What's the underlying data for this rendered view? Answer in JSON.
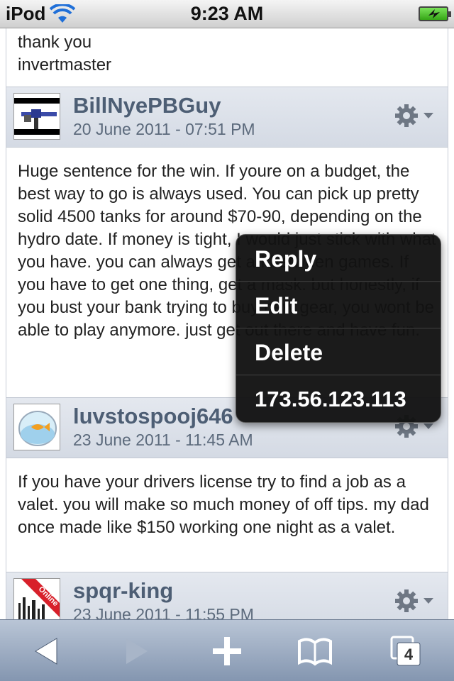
{
  "status_bar": {
    "carrier": "iPod",
    "time": "9:23 AM"
  },
  "top_post": {
    "lines": [
      "thank you",
      "invertmaster"
    ]
  },
  "posts": [
    {
      "username": "BillNyePBGuy",
      "date": "20 June 2011 - 07:51 PM",
      "body": "Huge sentence for the win. If youre on a budget, the best way to go is always used. You can pick up pretty solid 4500 tanks for around $70-90, depending on the hydro date. If money is tight, I would just stick with what you have. you can always get ari between games. If you have to get one thing, get a mask. but honestly, if you bust your bank trying to buy new gear, you wont be able to play anymore. just get out there and have fun."
    },
    {
      "username": "luvstospooj646",
      "date": "23 June 2011 - 11:45 AM",
      "body": "If you have your drivers license try to find a job as a valet. you will make so much money of off tips. my dad once made like $150 working one night as a valet."
    },
    {
      "username": "spqr-king",
      "date": "23 June 2011 - 11:55 PM",
      "badge": "Online"
    }
  ],
  "popup_menu": {
    "items": [
      "Reply",
      "Edit",
      "Delete",
      "173.56.123.113"
    ]
  },
  "toolbar": {
    "tabs_count": "4",
    "icons": [
      "back-arrow-icon",
      "forward-arrow-icon",
      "plus-icon",
      "bookmarks-icon",
      "pages-icon"
    ]
  },
  "colors": {
    "header_bg": "#dde2ea",
    "username": "#4d5e74",
    "popup_bg": "#121212",
    "toolbar": "#9aa8bd"
  }
}
